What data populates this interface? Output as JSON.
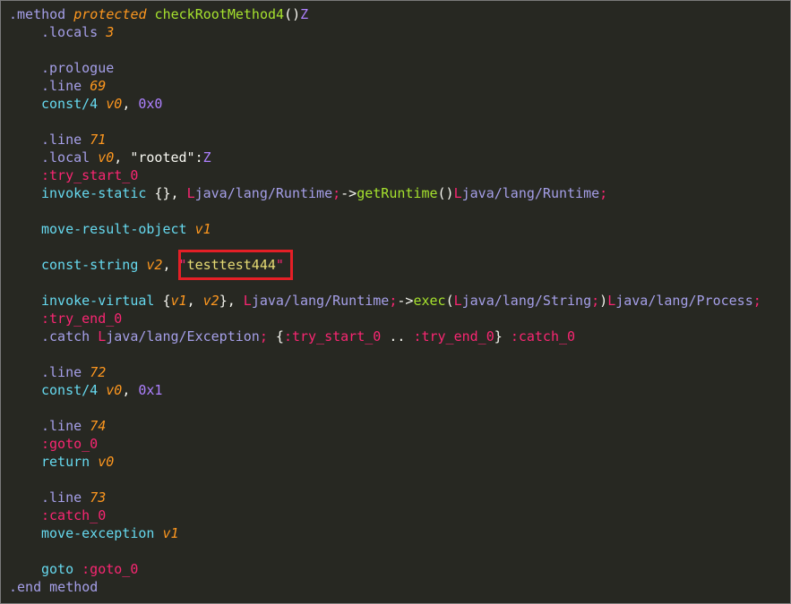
{
  "colors": {
    "background": "#272822",
    "default": "#f8f8f2",
    "keyword_blue": "#66d9ef",
    "directive_lavender": "#a59fe8",
    "orange": "#fd971f",
    "pink": "#f92672",
    "green": "#a6e22e",
    "purple": "#ae81ff",
    "string_yellow": "#e6db74",
    "highlight_box": "#e41f26"
  },
  "code_lines": [
    [
      {
        "t": ".method ",
        "c": "directive_lavender"
      },
      {
        "t": "protected",
        "c": "orange",
        "i": true
      },
      {
        "t": " checkRootMethod4",
        "c": "green"
      },
      {
        "t": "()",
        "c": "default"
      },
      {
        "t": "Z",
        "c": "purple"
      }
    ],
    [
      {
        "t": ".locals ",
        "c": "directive_lavender"
      },
      {
        "t": "3",
        "c": "orange",
        "i": true
      }
    ],
    [],
    [
      {
        "t": ".prologue",
        "c": "directive_lavender"
      }
    ],
    [
      {
        "t": ".line ",
        "c": "directive_lavender"
      },
      {
        "t": "69",
        "c": "orange",
        "i": true
      }
    ],
    [
      {
        "t": "const/4 ",
        "c": "keyword_blue"
      },
      {
        "t": "v0",
        "c": "orange",
        "i": true
      },
      {
        "t": ", ",
        "c": "default"
      },
      {
        "t": "0x0",
        "c": "purple"
      }
    ],
    [],
    [
      {
        "t": ".line ",
        "c": "directive_lavender"
      },
      {
        "t": "71",
        "c": "orange",
        "i": true
      }
    ],
    [
      {
        "t": ".local ",
        "c": "directive_lavender"
      },
      {
        "t": "v0",
        "c": "orange",
        "i": true
      },
      {
        "t": ", ",
        "c": "default"
      },
      {
        "t": "\"rooted\"",
        "c": "default"
      },
      {
        "t": ":",
        "c": "default"
      },
      {
        "t": "Z",
        "c": "purple"
      }
    ],
    [
      {
        "t": ":try_start_0",
        "c": "pink"
      }
    ],
    [
      {
        "t": "invoke-static ",
        "c": "keyword_blue"
      },
      {
        "t": "{}, ",
        "c": "default"
      },
      {
        "t": "L",
        "c": "pink"
      },
      {
        "t": "java/lang/Runtime",
        "c": "directive_lavender"
      },
      {
        "t": ";",
        "c": "pink"
      },
      {
        "t": "->",
        "c": "default"
      },
      {
        "t": "getRuntime",
        "c": "green"
      },
      {
        "t": "()",
        "c": "default"
      },
      {
        "t": "L",
        "c": "pink"
      },
      {
        "t": "java/lang/Runtime",
        "c": "directive_lavender"
      },
      {
        "t": ";",
        "c": "pink"
      }
    ],
    [],
    [
      {
        "t": "move-result-object ",
        "c": "keyword_blue"
      },
      {
        "t": "v1",
        "c": "orange",
        "i": true
      }
    ],
    [],
    [
      {
        "t": "const-string ",
        "c": "keyword_blue"
      },
      {
        "t": "v2",
        "c": "orange",
        "i": true
      },
      {
        "t": ", ",
        "c": "default"
      },
      {
        "t": "\"",
        "c": "pink"
      },
      {
        "t": "testtest444",
        "c": "string_yellow"
      },
      {
        "t": "\"",
        "c": "pink"
      }
    ],
    [],
    [
      {
        "t": "invoke-virtual ",
        "c": "keyword_blue"
      },
      {
        "t": "{",
        "c": "default"
      },
      {
        "t": "v1",
        "c": "orange",
        "i": true
      },
      {
        "t": ", ",
        "c": "default"
      },
      {
        "t": "v2",
        "c": "orange",
        "i": true
      },
      {
        "t": "}, ",
        "c": "default"
      },
      {
        "t": "L",
        "c": "pink"
      },
      {
        "t": "java/lang/Runtime",
        "c": "directive_lavender"
      },
      {
        "t": ";",
        "c": "pink"
      },
      {
        "t": "->",
        "c": "default"
      },
      {
        "t": "exec",
        "c": "green"
      },
      {
        "t": "(",
        "c": "default"
      },
      {
        "t": "L",
        "c": "pink"
      },
      {
        "t": "java/lang/String",
        "c": "directive_lavender"
      },
      {
        "t": ";",
        "c": "pink"
      },
      {
        "t": ")",
        "c": "default"
      },
      {
        "t": "L",
        "c": "pink"
      },
      {
        "t": "java/lang/Process",
        "c": "directive_lavender"
      },
      {
        "t": ";",
        "c": "pink"
      }
    ],
    [
      {
        "t": ":try_end_0",
        "c": "pink"
      }
    ],
    [
      {
        "t": ".catch ",
        "c": "directive_lavender"
      },
      {
        "t": "L",
        "c": "pink"
      },
      {
        "t": "java/lang/Exception",
        "c": "directive_lavender"
      },
      {
        "t": ";",
        "c": "pink"
      },
      {
        "t": " {",
        "c": "default"
      },
      {
        "t": ":try_start_0",
        "c": "pink"
      },
      {
        "t": " .. ",
        "c": "default"
      },
      {
        "t": ":try_end_0",
        "c": "pink"
      },
      {
        "t": "} ",
        "c": "default"
      },
      {
        "t": ":catch_0",
        "c": "pink"
      }
    ],
    [],
    [
      {
        "t": ".line ",
        "c": "directive_lavender"
      },
      {
        "t": "72",
        "c": "orange",
        "i": true
      }
    ],
    [
      {
        "t": "const/4 ",
        "c": "keyword_blue"
      },
      {
        "t": "v0",
        "c": "orange",
        "i": true
      },
      {
        "t": ", ",
        "c": "default"
      },
      {
        "t": "0x1",
        "c": "purple"
      }
    ],
    [],
    [
      {
        "t": ".line ",
        "c": "directive_lavender"
      },
      {
        "t": "74",
        "c": "orange",
        "i": true
      }
    ],
    [
      {
        "t": ":goto_0",
        "c": "pink"
      }
    ],
    [
      {
        "t": "return ",
        "c": "keyword_blue"
      },
      {
        "t": "v0",
        "c": "orange",
        "i": true
      }
    ],
    [],
    [
      {
        "t": ".line ",
        "c": "directive_lavender"
      },
      {
        "t": "73",
        "c": "orange",
        "i": true
      }
    ],
    [
      {
        "t": ":catch_0",
        "c": "pink"
      }
    ],
    [
      {
        "t": "move-exception ",
        "c": "keyword_blue"
      },
      {
        "t": "v1",
        "c": "orange",
        "i": true
      }
    ],
    [],
    [
      {
        "t": "goto ",
        "c": "keyword_blue"
      },
      {
        "t": ":goto_0",
        "c": "pink"
      }
    ],
    [
      {
        "t": ".end method",
        "c": "directive_lavender"
      }
    ]
  ]
}
